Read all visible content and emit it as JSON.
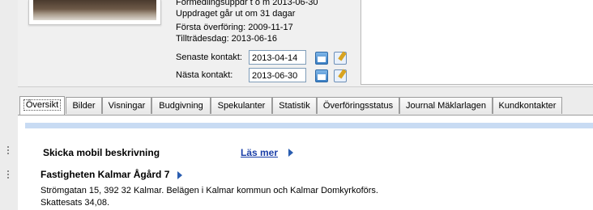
{
  "assignment": {
    "line1": "Förmedlingsuppdr t o m 2013-06-30",
    "line2": "Uppdraget går ut om 31 dagar",
    "first_transfer": "Första överföring: 2009-11-17",
    "access_day": "Tillträdesdag: 2013-06-16"
  },
  "contacts": {
    "latest_label": "Senaste kontakt:",
    "latest_value": "2013-04-14",
    "next_label": "Nästa kontakt:",
    "next_value": "2013-06-30"
  },
  "tabs": [
    {
      "label": "Översikt"
    },
    {
      "label": "Bilder"
    },
    {
      "label": "Visningar"
    },
    {
      "label": "Budgivning"
    },
    {
      "label": "Spekulanter"
    },
    {
      "label": "Statistik"
    },
    {
      "label": "Överföringsstatus"
    },
    {
      "label": "Journal Mäklarlagen"
    },
    {
      "label": "Kundkontakter"
    }
  ],
  "overview": {
    "mobile_title": "Skicka mobil beskrivning",
    "read_more": "Läs mer",
    "property_title": "Fastigheten Kalmar Ågård 7",
    "address_line": "Strömgatan 15, 392 32 Kalmar. Belägen i Kalmar kommun och Kalmar Domkyrkoförs.",
    "tax_line": "Skattesats 34,08."
  }
}
